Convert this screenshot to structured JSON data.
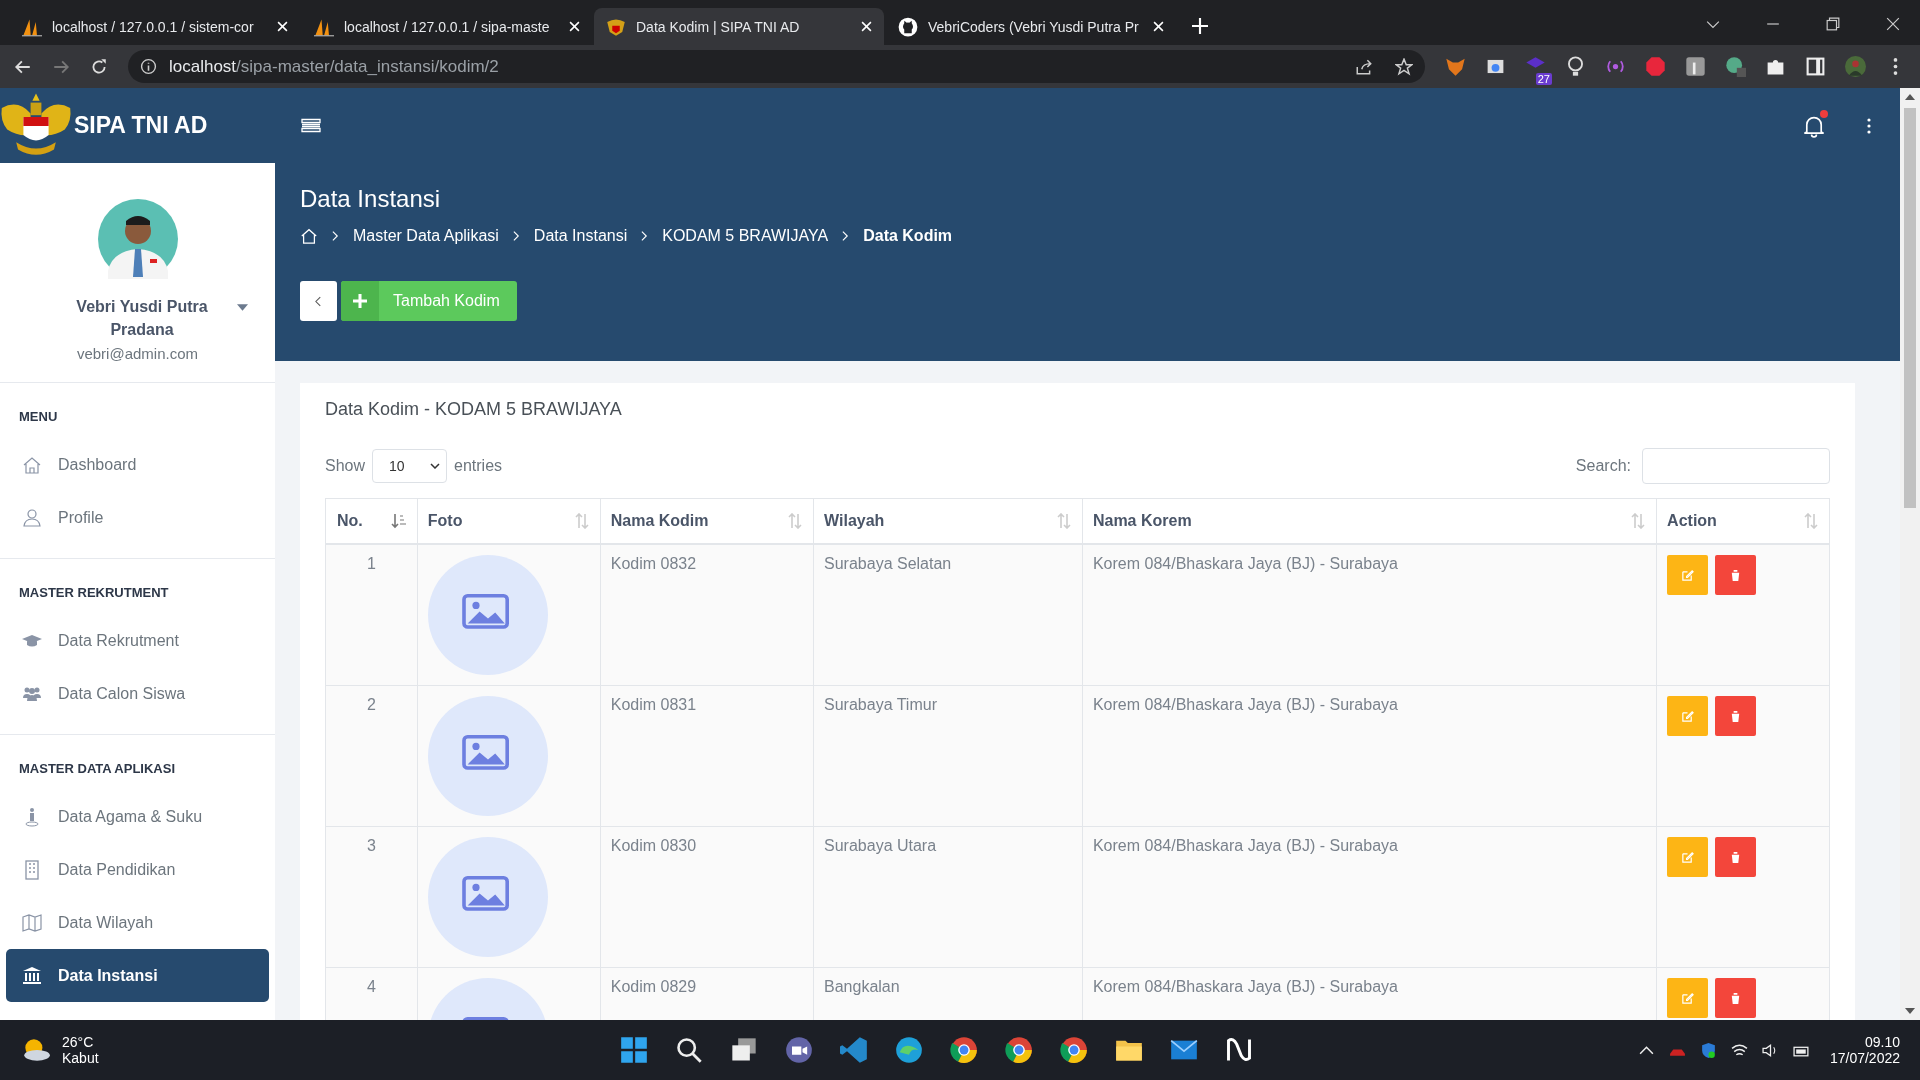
{
  "browser": {
    "tabs": [
      {
        "title": "localhost / 127.0.0.1 / sistem-cor",
        "selected": false,
        "kind": "pma"
      },
      {
        "title": "localhost / 127.0.0.1 / sipa-maste",
        "selected": false,
        "kind": "pma"
      },
      {
        "title": "Data Kodim | SIPA TNI AD",
        "selected": true,
        "kind": "app"
      },
      {
        "title": "VebriCoders (Vebri Yusdi Putra Pr",
        "selected": false,
        "kind": "github"
      }
    ],
    "url_host": "localhost",
    "url_path": "/sipa-master/data_instansi/kodim/2",
    "extension_badge": "27"
  },
  "app": {
    "brand": "SIPA TNI AD",
    "notification": true,
    "user": {
      "name": "Vebri Yusdi Putra Pradana",
      "email": "vebri@admin.com"
    },
    "menu": [
      {
        "heading": "MENU",
        "items": [
          {
            "label": "Dashboard",
            "selected": false
          },
          {
            "label": "Profile",
            "selected": false
          }
        ]
      },
      {
        "heading": "MASTER REKRUTMENT",
        "items": [
          {
            "label": "Data Rekrutment",
            "selected": false
          },
          {
            "label": "Data Calon Siswa",
            "selected": false
          }
        ]
      },
      {
        "heading": "MASTER DATA APLIKASI",
        "items": [
          {
            "label": "Data Agama & Suku",
            "selected": false
          },
          {
            "label": "Data Pendidikan",
            "selected": false
          },
          {
            "label": "Data Wilayah",
            "selected": false
          },
          {
            "label": "Data Instansi",
            "selected": true
          }
        ]
      }
    ],
    "page_title": "Data Instansi",
    "breadcrumb": [
      {
        "label": "Master Data Aplikasi",
        "current": false
      },
      {
        "label": "Data Instansi",
        "current": false
      },
      {
        "label": "KODAM 5 BRAWIJAYA",
        "current": false
      },
      {
        "label": "Data Kodim",
        "current": true
      }
    ],
    "add_button": "Tambah Kodim",
    "card_title": "Data Kodim - KODAM 5 BRAWIJAYA",
    "show_label": "Show",
    "entries_value": "10",
    "entries_label": "entries",
    "search_label": "Search:",
    "columns": [
      {
        "label": "No.",
        "sorted": true
      },
      {
        "label": "Foto",
        "sorted": false
      },
      {
        "label": "Nama Kodim",
        "sorted": false
      },
      {
        "label": "Wilayah",
        "sorted": false
      },
      {
        "label": "Nama Korem",
        "sorted": false
      },
      {
        "label": "Action",
        "sorted": false
      }
    ],
    "rows": [
      {
        "no": "1",
        "kodim": "Kodim 0832",
        "wilayah": "Surabaya Selatan",
        "korem": "Korem 084/Bhaskara Jaya (BJ) - Surabaya"
      },
      {
        "no": "2",
        "kodim": "Kodim 0831",
        "wilayah": "Surabaya Timur",
        "korem": "Korem 084/Bhaskara Jaya (BJ) - Surabaya"
      },
      {
        "no": "3",
        "kodim": "Kodim 0830",
        "wilayah": "Surabaya Utara",
        "korem": "Korem 084/Bhaskara Jaya (BJ) - Surabaya"
      },
      {
        "no": "4",
        "kodim": "Kodim 0829",
        "wilayah": "Bangkalan",
        "korem": "Korem 084/Bhaskara Jaya (BJ) - Surabaya"
      }
    ]
  },
  "taskbar": {
    "temperature": "26°C",
    "weather": "Kabut",
    "time": "09.10",
    "date": "17/07/2022"
  }
}
